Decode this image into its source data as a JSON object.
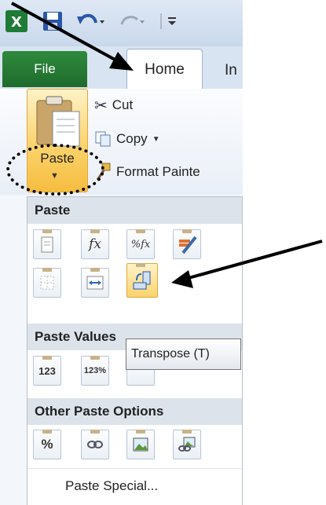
{
  "ribbon_tabs": {
    "file": "File",
    "home": "Home",
    "insert": "In"
  },
  "clipboard": {
    "paste_label": "Paste",
    "cut_label": "Cut",
    "copy_label": "Copy",
    "format_painter_label": "Format Painte"
  },
  "paste_menu": {
    "section_paste": "Paste",
    "section_paste_values": "Paste Values",
    "section_other": "Other Paste Options",
    "paste_special": "Paste Special...",
    "fx_text": "fx",
    "pct_fx_text": "%fx",
    "values_123": "123",
    "values_pct": "123%",
    "other_pct": "%"
  },
  "tooltip": {
    "transpose": "Transpose (T)"
  },
  "colors": {
    "file_tab": "#1f6b2c",
    "highlight": "#fbd36d",
    "arrow": "#000000"
  }
}
